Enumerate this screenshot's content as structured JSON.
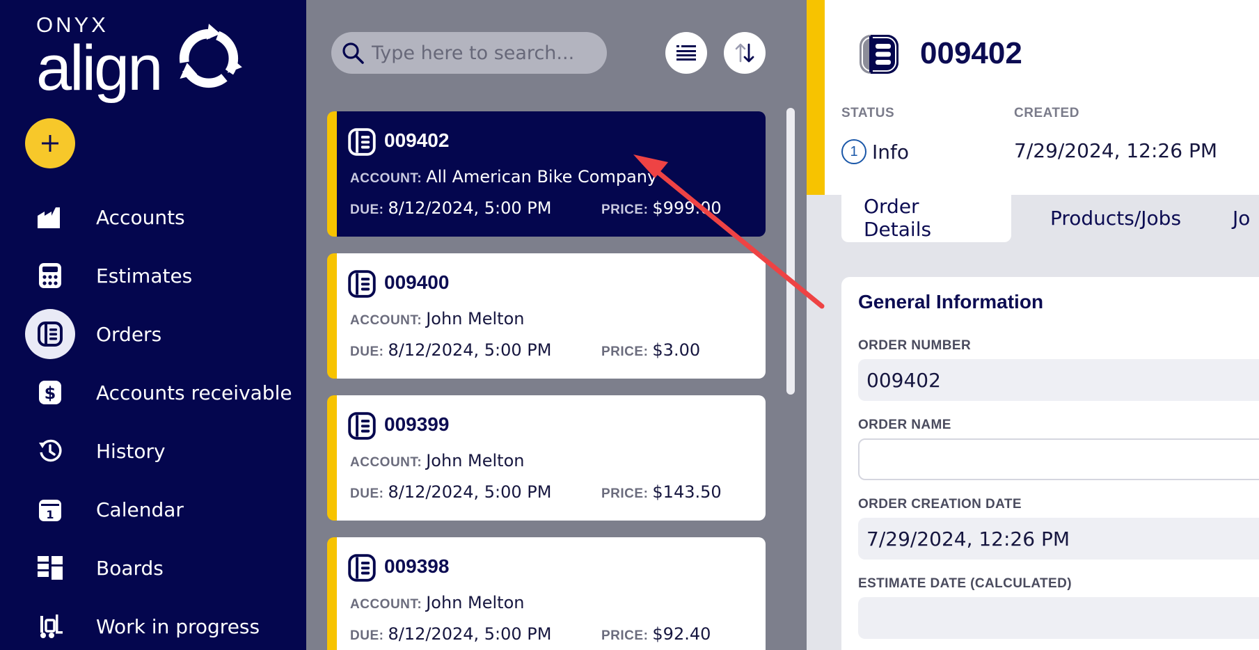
{
  "brand": {
    "top": "ONYX",
    "main": "align"
  },
  "sidebar": {
    "add_icon": "plus-icon",
    "items": [
      {
        "label": "Accounts",
        "icon": "factory-icon"
      },
      {
        "label": "Estimates",
        "icon": "calculator-icon"
      },
      {
        "label": "Orders",
        "icon": "order-icon",
        "active": true
      },
      {
        "label": "Accounts receivable",
        "icon": "dollar-icon"
      },
      {
        "label": "History",
        "icon": "history-icon"
      },
      {
        "label": "Calendar",
        "icon": "calendar-icon"
      },
      {
        "label": "Boards",
        "icon": "boards-icon"
      },
      {
        "label": "Work in progress",
        "icon": "forklift-icon"
      }
    ]
  },
  "search": {
    "placeholder": "Type here to search..."
  },
  "toolbar": {
    "filter_icon": "list-icon",
    "sort_icon": "sort-icon"
  },
  "labels": {
    "account": "ACCOUNT:",
    "due": "DUE:",
    "price": "PRICE:"
  },
  "orders": [
    {
      "number": "009402",
      "account": "All American Bike Company",
      "due": "8/12/2024, 5:00 PM",
      "price": "$999.00",
      "active": true
    },
    {
      "number": "009400",
      "account": "John Melton",
      "due": "8/12/2024, 5:00 PM",
      "price": "$3.00"
    },
    {
      "number": "009399",
      "account": "John Melton",
      "due": "8/12/2024, 5:00 PM",
      "price": "$143.50"
    },
    {
      "number": "009398",
      "account": "John Melton",
      "due": "8/12/2024, 5:00 PM",
      "price": "$92.40"
    }
  ],
  "detail": {
    "number": "009402",
    "status_label": "STATUS",
    "status_number": "1",
    "status_value": "Info",
    "created_label": "CREATED",
    "created_value": "7/29/2024, 12:26 PM",
    "tabs": [
      "Order Details",
      "Products/Jobs",
      "Jo"
    ],
    "section_title": "General Information",
    "fields": [
      {
        "label": "ORDER NUMBER",
        "value": "009402"
      },
      {
        "label": "ORDER NAME",
        "value": ""
      },
      {
        "label": "ORDER CREATION DATE",
        "value": "7/29/2024, 12:26 PM"
      },
      {
        "label": "ESTIMATE DATE (CALCULATED)",
        "value": ""
      }
    ]
  },
  "colors": {
    "navy": "#04064e",
    "accent_yellow": "#f7c300",
    "arrow_red": "#ee4344"
  }
}
